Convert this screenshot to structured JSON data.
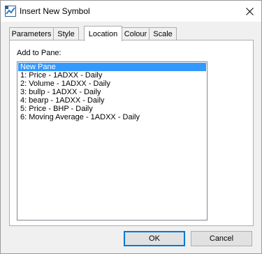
{
  "window": {
    "title": "Insert New Symbol",
    "close_glyph": "✕"
  },
  "tabs": [
    {
      "label": "Parameters"
    },
    {
      "label": "Style"
    },
    {
      "label": "Location"
    },
    {
      "label": "Colour"
    },
    {
      "label": "Scale"
    }
  ],
  "active_tab": "Location",
  "location": {
    "add_to_pane_label": "Add to Pane:",
    "panes": [
      "New Pane",
      "1:  Price - 1ADXX - Daily",
      "2:  Volume - 1ADXX - Daily",
      "3:  bullp - 1ADXX - Daily",
      "4:  bearp - 1ADXX - Daily",
      "5:  Price - BHP - Daily",
      "6:  Moving Average - 1ADXX - Daily"
    ],
    "selected_pane": "New Pane"
  },
  "buttons": {
    "ok": "OK",
    "cancel": "Cancel"
  },
  "colors": {
    "selection": "#3399ff",
    "default_button_border": "#0078d7"
  }
}
